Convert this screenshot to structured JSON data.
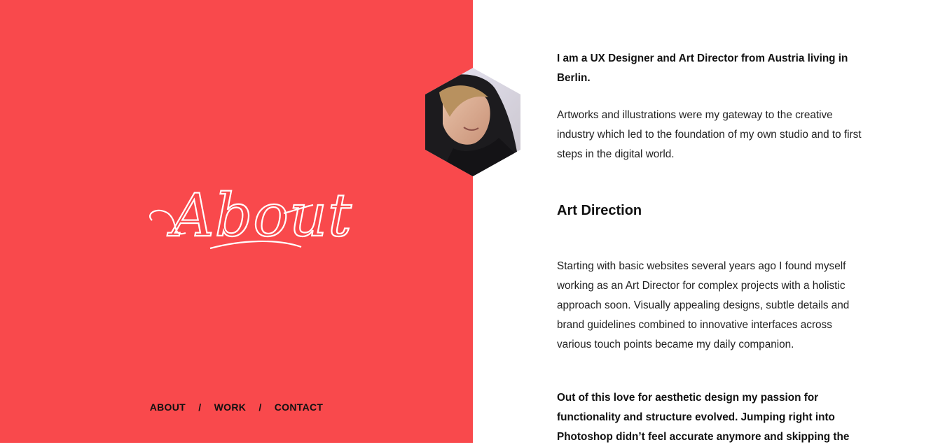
{
  "left": {
    "background_color": "#f9494c",
    "script_title": "About"
  },
  "nav": {
    "items": [
      "ABOUT",
      "WORK",
      "CONTACT"
    ],
    "separator": "/"
  },
  "portrait": {
    "icon": "hexagon-portrait"
  },
  "content": {
    "intro": "I am a UX Designer and Art Director from Austria living in Berlin.",
    "paragraph1": "Artworks and illustrations were my gateway to the creative industry which led to the foundation of my own studio and to first steps in the digital world.",
    "heading": "Art Direction",
    "paragraph2": "Starting with basic websites several years ago I found myself working as an Art Director for complex projects with a holistic approach soon. Visually appealing designs, subtle details and brand guidelines combined to innovative interfaces across various touch points became my daily companion.",
    "paragraph3": "Out of this love for aesthetic design my passion for functionality and structure evolved. Jumping right into Photoshop didn’t feel accurate anymore and skipping the"
  }
}
